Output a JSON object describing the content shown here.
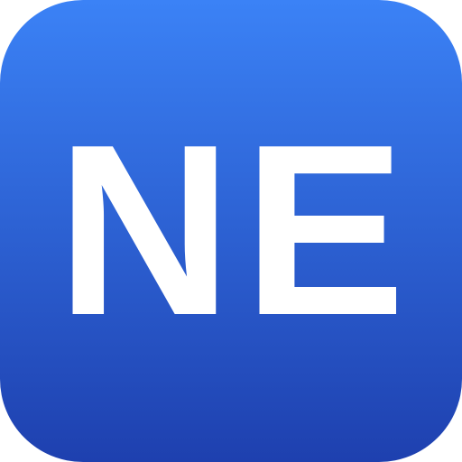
{
  "icon": {
    "monogram": "NE",
    "gradient_top_color": "#3B82F6",
    "gradient_bottom_color": "#1E40AF",
    "text_color": "#FFFFFF"
  }
}
